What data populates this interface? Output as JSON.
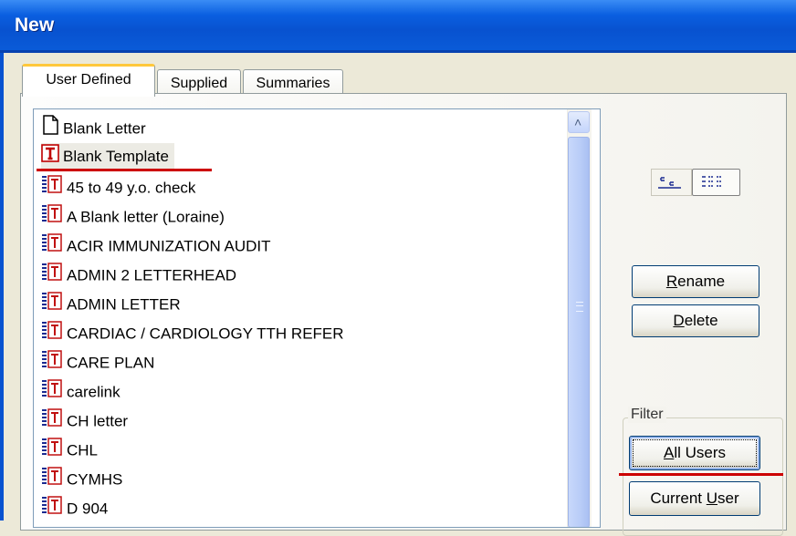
{
  "window": {
    "title": "New"
  },
  "tabs": [
    {
      "label": "User Defined",
      "active": true
    },
    {
      "label": "Supplied",
      "active": false
    },
    {
      "label": "Summaries",
      "active": false
    }
  ],
  "list": {
    "items": [
      {
        "label": "Blank Letter",
        "icon": "blank-document-icon"
      },
      {
        "label": "Blank Template",
        "icon": "template-icon",
        "selected": true
      },
      {
        "label": "45 to 49 y.o. check",
        "icon": "user-template-icon"
      },
      {
        "label": "A Blank letter (Loraine)",
        "icon": "user-template-icon"
      },
      {
        "label": "ACIR IMMUNIZATION AUDIT",
        "icon": "user-template-icon"
      },
      {
        "label": "ADMIN 2 LETTERHEAD",
        "icon": "user-template-icon"
      },
      {
        "label": "ADMIN LETTER",
        "icon": "user-template-icon"
      },
      {
        "label": "CARDIAC / CARDIOLOGY TTH REFER",
        "icon": "user-template-icon"
      },
      {
        "label": "CARE PLAN",
        "icon": "user-template-icon"
      },
      {
        "label": "carelink",
        "icon": "user-template-icon"
      },
      {
        "label": "CH letter",
        "icon": "user-template-icon"
      },
      {
        "label": "CHL",
        "icon": "user-template-icon"
      },
      {
        "label": "CYMHS",
        "icon": "user-template-icon"
      },
      {
        "label": "D 904",
        "icon": "user-template-icon"
      }
    ]
  },
  "buttons": {
    "rename": {
      "first": "R",
      "rest": "ename"
    },
    "delete": {
      "first": "D",
      "rest": "elete"
    }
  },
  "filter": {
    "label": "Filter",
    "all_users": {
      "pre": "",
      "u": "A",
      "post": "ll Users"
    },
    "current_user": {
      "pre": "Current ",
      "u": "U",
      "post": "ser"
    }
  },
  "colors": {
    "title_bar": "#0a5fe0",
    "annotation_underline": "#cc0000",
    "active_tab_accent": "#ffc83c"
  }
}
